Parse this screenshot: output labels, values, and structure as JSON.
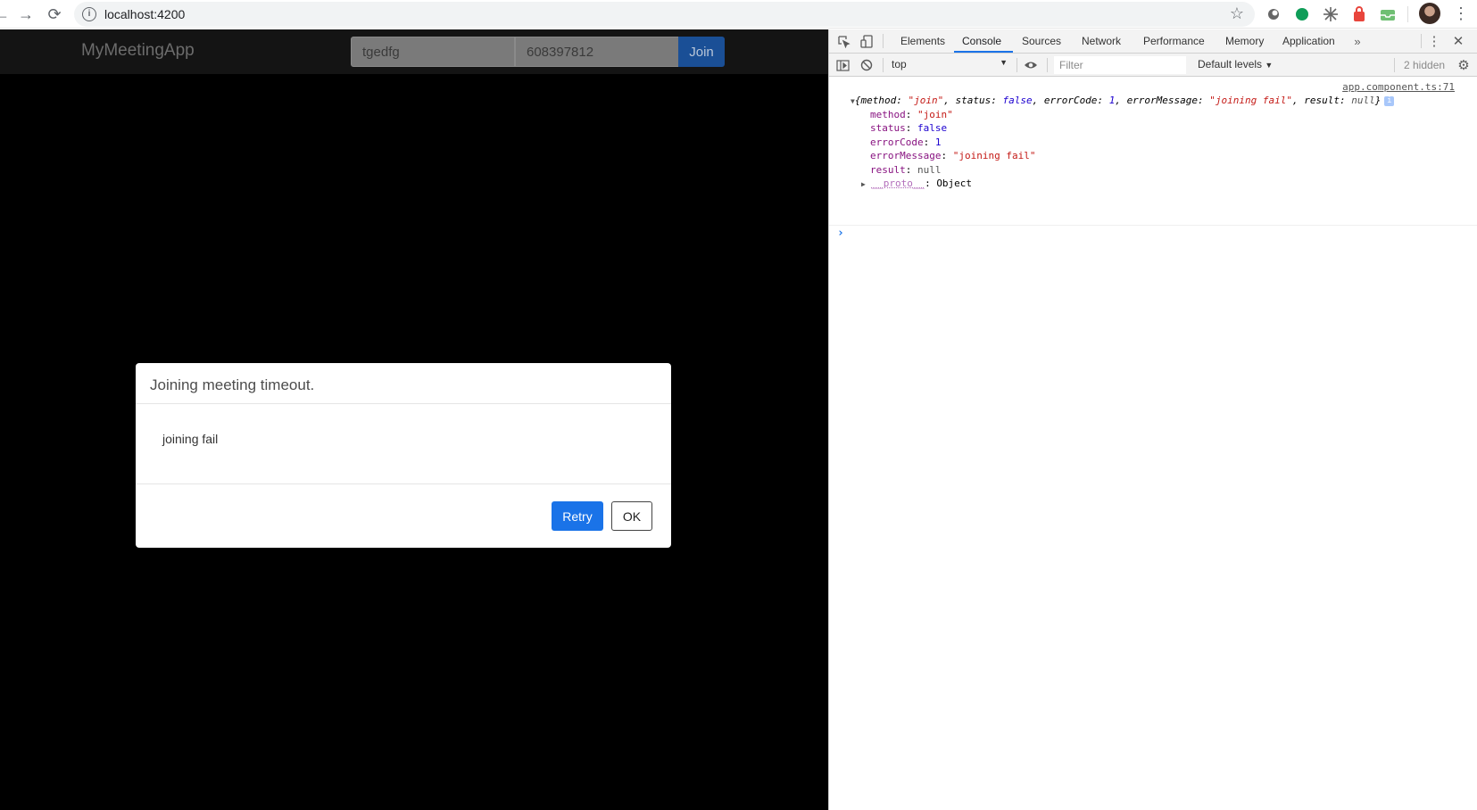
{
  "browser": {
    "url": "localhost:4200"
  },
  "app": {
    "brand": "MyMeetingApp",
    "name_value": "tgedfg",
    "meeting_id_value": "608397812",
    "join_label": "Join"
  },
  "modal": {
    "title": "Joining meeting timeout.",
    "message": "joining fail",
    "retry_label": "Retry",
    "ok_label": "OK"
  },
  "devtools": {
    "tabs": [
      "Elements",
      "Console",
      "Sources",
      "Network",
      "Performance",
      "Memory",
      "Application"
    ],
    "active_tab": "Console",
    "context": "top",
    "filter_placeholder": "Filter",
    "levels_label": "Default levels",
    "hidden_label": "2 hidden",
    "source_link": "app.component.ts:71",
    "log": {
      "method_key": "method",
      "method_value": "\"join\"",
      "status_key": "status",
      "status_value": "false",
      "errorCode_key": "errorCode",
      "errorCode_value": "1",
      "errorMessage_key": "errorMessage",
      "errorMessage_value": "\"joining fail\"",
      "result_key": "result",
      "result_value": "null",
      "proto_key": "__proto__",
      "proto_value": "Object"
    }
  },
  "colors": {
    "accent": "#1a73e8",
    "join_button": "#1a4f96"
  }
}
